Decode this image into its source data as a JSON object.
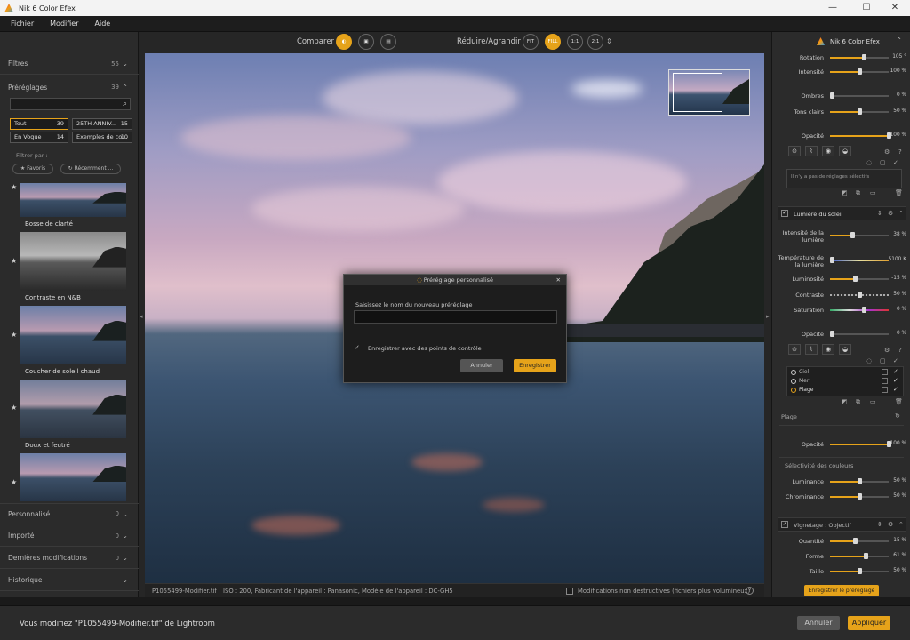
{
  "window": {
    "title": "Nik 6 Color Efex",
    "minimize": "—",
    "maximize": "☐",
    "close": "✕"
  },
  "menu": [
    "Fichier",
    "Modifier",
    "Aide"
  ],
  "left": {
    "filtres": {
      "label": "Filtres",
      "count": "55"
    },
    "preglages": {
      "label": "Préréglages",
      "count": "39"
    },
    "tags": [
      {
        "label": "Tout",
        "count": "39"
      },
      {
        "label": "25TH ANNIV...",
        "count": "15"
      },
      {
        "label": "En Vogue",
        "count": "14"
      },
      {
        "label": "Exemples de co...",
        "count": "10"
      }
    ],
    "filter_by": "Filtrer par :",
    "pills": [
      "★ Favoris",
      "↻ Récemment ..."
    ],
    "thumbs": [
      "Bosse de clarté",
      "Contraste en N&B",
      "Coucher de soleil chaud",
      "Doux et feutré"
    ],
    "sections": [
      {
        "label": "Personnalisé",
        "count": "0"
      },
      {
        "label": "Importé",
        "count": "0"
      },
      {
        "label": "Dernières modifications",
        "count": "0"
      },
      {
        "label": "Historique",
        "count": ""
      }
    ]
  },
  "toolbar": {
    "compare": "Comparer",
    "zoom": "Réduire/Agrandir",
    "fit": "FIT",
    "fill": "FILL",
    "one": "1:1",
    "two": "2:1"
  },
  "status": {
    "file": "P1055499-Modifier.tif",
    "meta": "ISO : 200, Fabricant de l'appareil : Panasonic, Modèle de l'appareil : DC-GH5",
    "nondestructive": "Modifications non destructives (fichiers plus volumineux)"
  },
  "dialog": {
    "title": "Préréglage personnalisé",
    "prompt": "Saisissez le nom du nouveau préréglage",
    "input_value": "",
    "checkbox": "Enregistrer avec des points de contrôle",
    "cancel": "Annuler",
    "save": "Enregistrer"
  },
  "right": {
    "title": "Nik 6 Color Efex",
    "top_sliders": [
      {
        "label": "Rotation",
        "value": "105 °",
        "level": 0.58
      },
      {
        "label": "Intensité",
        "value": "100 %",
        "level": 0.5
      },
      {
        "label": "Ombres",
        "value": "0 %",
        "level": 0.0
      },
      {
        "label": "Tons clairs",
        "value": "50 %",
        "level": 0.5
      },
      {
        "label": "Opacité",
        "value": "100 %",
        "level": 1.0
      }
    ],
    "no_selective": "Il n'y a pas de réglages sélectifs",
    "sunlight": {
      "title": "Lumière du soleil"
    },
    "sun_sliders": [
      {
        "label": "Intensité de la lumière",
        "value": "38 %",
        "level": 0.38
      },
      {
        "label": "Température de la lumière",
        "value": "5100 K",
        "level": 0.0
      },
      {
        "label": "Luminosité",
        "value": "-15 %",
        "level": 0.43
      },
      {
        "label": "Contraste",
        "value": "50 %",
        "level": 0.5
      },
      {
        "label": "Saturation",
        "value": "0 %",
        "level": 0.58
      },
      {
        "label": "Opacité",
        "value": "0 %",
        "level": 0.0
      }
    ],
    "control_points": [
      "Ciel",
      "Mer",
      "Plage"
    ],
    "plage_label": "Plage",
    "plage_opacity": {
      "label": "Opacité",
      "value": "100 %",
      "level": 1.0
    },
    "color_selectivity": "Sélectivité des couleurs",
    "color_sliders": [
      {
        "label": "Luminance",
        "value": "50 %",
        "level": 0.5
      },
      {
        "label": "Chrominance",
        "value": "50 %",
        "level": 0.5
      }
    ],
    "vignette": {
      "title": "Vignetage : Objectif"
    },
    "vignette_sliders": [
      {
        "label": "Quantité",
        "value": "-15 %",
        "level": 0.43
      },
      {
        "label": "Forme",
        "value": "61 %",
        "level": 0.6
      },
      {
        "label": "Taille",
        "value": "50 %",
        "level": 0.5
      }
    ],
    "save_preset": "Enregistrer le préréglage"
  },
  "footer": {
    "message": "Vous modifiez \"P1055499-Modifier.tif\" de Lightroom",
    "cancel": "Annuler",
    "apply": "Appliquer"
  },
  "colors": {
    "accent": "#e6a31a",
    "panel": "#2b2b2b",
    "background": "#202020"
  }
}
